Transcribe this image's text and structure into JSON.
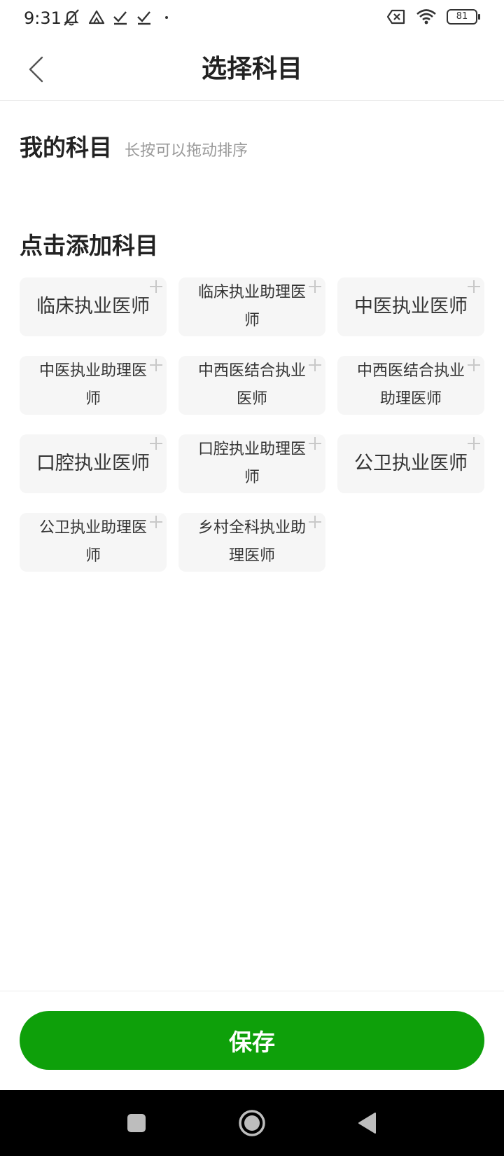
{
  "status_bar": {
    "time": "9:31",
    "battery": "81",
    "icons": [
      "mute-icon",
      "drive-icon",
      "check-icon",
      "check-icon",
      "dot-icon",
      "no-sim-icon",
      "wifi-icon",
      "battery-icon"
    ]
  },
  "header": {
    "title": "选择科目",
    "back_icon": "chevron-left-icon"
  },
  "my_subjects": {
    "title": "我的科目",
    "hint": "长按可以拖动排序",
    "items": []
  },
  "add_subjects": {
    "title": "点击添加科目",
    "items": [
      {
        "label": "临床执业医师"
      },
      {
        "label": "临床执业助理医师"
      },
      {
        "label": "中医执业医师"
      },
      {
        "label": "中医执业助理医师"
      },
      {
        "label": "中西医结合执业医师"
      },
      {
        "label": "中西医结合执业助理医师"
      },
      {
        "label": "口腔执业医师"
      },
      {
        "label": "口腔执业助理医师"
      },
      {
        "label": "公卫执业医师"
      },
      {
        "label": "公卫执业助理医师"
      },
      {
        "label": "乡村全科执业助理医师"
      }
    ]
  },
  "footer": {
    "save_label": "保存"
  },
  "colors": {
    "accent": "#0ea00a",
    "chip_bg": "#f6f6f6"
  }
}
